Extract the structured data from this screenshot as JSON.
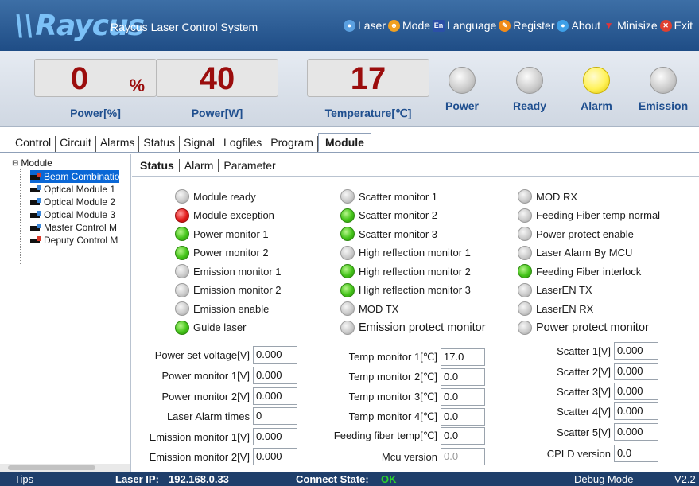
{
  "app": {
    "logo_text": "Raycus",
    "title": "Raycus Laser Control System"
  },
  "menu": [
    {
      "label": "Laser",
      "icon": "laser-icon",
      "color": "#5ba0e0"
    },
    {
      "label": "Mode",
      "icon": "users-icon",
      "color": "#f0a020"
    },
    {
      "label": "Language",
      "icon": "en-icon",
      "color": "#2b4fa8"
    },
    {
      "label": "Register",
      "icon": "register-icon",
      "color": "#f08a18"
    },
    {
      "label": "About",
      "icon": "about-icon",
      "color": "#3ea0e8"
    },
    {
      "label": "Minisize",
      "icon": "minimize-icon",
      "color": "#e0353a"
    },
    {
      "label": "Exit",
      "icon": "exit-icon",
      "color": "#e04030"
    }
  ],
  "readouts": [
    {
      "value": "0",
      "unit": "%",
      "label": "Power[%]"
    },
    {
      "value": "40",
      "unit": "",
      "label": "Power[W]"
    },
    {
      "value": "17",
      "unit": "",
      "label": "Temperature[℃]"
    }
  ],
  "lamps": [
    {
      "label": "Power",
      "on": false
    },
    {
      "label": "Ready",
      "on": false
    },
    {
      "label": "Alarm",
      "on": true
    },
    {
      "label": "Emission",
      "on": false
    }
  ],
  "tabs": [
    "Control",
    "Circuit",
    "Alarms",
    "Status",
    "Signal",
    "Logfiles",
    "Program",
    "Module"
  ],
  "active_tab": "Module",
  "tree": {
    "root": "Module",
    "items": [
      {
        "label": "Beam Combinatio",
        "selected": true,
        "badge": "red"
      },
      {
        "label": "Optical Module 1",
        "selected": false,
        "badge": "blue"
      },
      {
        "label": "Optical Module 2",
        "selected": false,
        "badge": "blue"
      },
      {
        "label": "Optical Module 3",
        "selected": false,
        "badge": "blue"
      },
      {
        "label": "Master Control M",
        "selected": false,
        "badge": "blue"
      },
      {
        "label": "Deputy Control M",
        "selected": false,
        "badge": "red"
      }
    ]
  },
  "subtabs": [
    "Status",
    "Alarm",
    "Parameter"
  ],
  "active_subtab": "Status",
  "indicators": {
    "col1": [
      {
        "label": "Module ready",
        "state": "grey"
      },
      {
        "label": "Module exception",
        "state": "red"
      },
      {
        "label": "Power monitor 1",
        "state": "green"
      },
      {
        "label": "Power monitor 2",
        "state": "green"
      },
      {
        "label": "Emission monitor 1",
        "state": "grey"
      },
      {
        "label": "Emission monitor 2",
        "state": "grey"
      },
      {
        "label": "Emission enable",
        "state": "grey"
      },
      {
        "label": "Guide laser",
        "state": "green"
      }
    ],
    "col2": [
      {
        "label": "Scatter monitor 1",
        "state": "grey"
      },
      {
        "label": "Scatter monitor 2",
        "state": "green"
      },
      {
        "label": "Scatter monitor 3",
        "state": "green"
      },
      {
        "label": "High reflection monitor 1",
        "state": "grey"
      },
      {
        "label": "High reflection monitor 2",
        "state": "green"
      },
      {
        "label": "High reflection monitor 3",
        "state": "green"
      },
      {
        "label": "MOD TX",
        "state": "grey"
      },
      {
        "label": "Emission protect monitor",
        "state": "grey"
      }
    ],
    "col3": [
      {
        "label": "MOD RX",
        "state": "grey"
      },
      {
        "label": "Feeding Fiber temp normal",
        "state": "grey"
      },
      {
        "label": "Power protect enable",
        "state": "grey"
      },
      {
        "label": "Laser Alarm By MCU",
        "state": "grey"
      },
      {
        "label": "Feeding Fiber interlock",
        "state": "green"
      },
      {
        "label": "LaserEN TX",
        "state": "grey"
      },
      {
        "label": "LaserEN RX",
        "state": "grey"
      },
      {
        "label": "Power protect monitor",
        "state": "grey"
      }
    ]
  },
  "fields": {
    "col1": [
      {
        "label": "Power set voltage[V]",
        "value": "0.000"
      },
      {
        "label": "Power monitor 1[V]",
        "value": "0.000"
      },
      {
        "label": "Power monitor 2[V]",
        "value": "0.000"
      },
      {
        "label": "Laser Alarm times",
        "value": "0"
      },
      {
        "label": "Emission monitor 1[V]",
        "value": "0.000"
      },
      {
        "label": "Emission monitor 2[V]",
        "value": "0.000"
      }
    ],
    "col2": [
      {
        "label": "Temp monitor 1[℃]",
        "value": "17.0"
      },
      {
        "label": "Temp monitor 2[℃]",
        "value": "0.0"
      },
      {
        "label": "Temp monitor 3[℃]",
        "value": "0.0"
      },
      {
        "label": "Temp monitor 4[℃]",
        "value": "0.0"
      },
      {
        "label": "Feeding fiber temp[℃]",
        "value": "0.0"
      },
      {
        "label": "Mcu version",
        "value": "0.0"
      }
    ],
    "col3": [
      {
        "label": "Scatter 1[V]",
        "value": "0.000"
      },
      {
        "label": "Scatter 2[V]",
        "value": "0.000"
      },
      {
        "label": "Scatter 3[V]",
        "value": "0.000"
      },
      {
        "label": "Scatter 4[V]",
        "value": "0.000"
      },
      {
        "label": "Scatter 5[V]",
        "value": "0.000"
      },
      {
        "label": "CPLD version",
        "value": "0.0"
      }
    ]
  },
  "statusbar": {
    "tips": "Tips",
    "laser_ip_label": "Laser IP:",
    "laser_ip": "192.168.0.33",
    "connect_label": "Connect State:",
    "connect_state": "OK",
    "connect_color": "#2bd42b",
    "mode": "Debug Mode",
    "version": "V2.2"
  }
}
